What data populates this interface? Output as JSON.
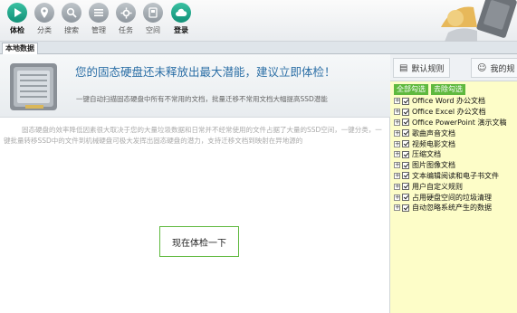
{
  "toolbar": {
    "items": [
      {
        "label": "体检",
        "icon": "play-icon",
        "active": true
      },
      {
        "label": "分类",
        "icon": "location-pin-icon"
      },
      {
        "label": "搜索",
        "icon": "search-icon"
      },
      {
        "label": "管理",
        "icon": "list-icon"
      },
      {
        "label": "任务",
        "icon": "gear-icon"
      },
      {
        "label": "空间",
        "icon": "disk-icon"
      },
      {
        "label": "登录",
        "icon": "cloud-icon",
        "highlight": true
      }
    ]
  },
  "tabs": {
    "local": "本地数据"
  },
  "banner": {
    "title": "您的固态硬盘还未释放出最大潜能，建议立即体检！",
    "subtitle": "一键自动扫描固态硬盘中所有不常用的文档，批量迁移不常用文档大幅提高SSD潜能"
  },
  "description": "固态硬盘的效率降低因素很大取决于您的大量垃圾数据和日常并不经常使用的文件占据了大量的SSD空间，一键分类，一键批量转移SSD中的文件到机械硬盘可极大发挥出固态硬盘的潜力，支持迁移文档到映射在异地源的",
  "check_button": "现在体检一下",
  "right_panel": {
    "tabs": [
      "默认规则",
      "我的规"
    ],
    "select_all": "全部勾选",
    "deselect_all": "去除勾选",
    "rules": [
      "Office Word 办公文档",
      "Office Excel 办公文档",
      "Office PowerPoint 演示文稿",
      "歌曲声音文档",
      "视频电影文档",
      "压缩文档",
      "图片图像文档",
      "文本编辑阅读和电子书文件",
      "用户自定义规则",
      "占用硬盘空间的垃圾清理",
      "自动忽略系统产生的数据"
    ]
  },
  "colors": {
    "accent_green": "#5fb93e",
    "toolbar_teal": "#1aa384",
    "banner_title": "#2c6fa6",
    "rule_panel_bg": "#fdfdc8"
  }
}
